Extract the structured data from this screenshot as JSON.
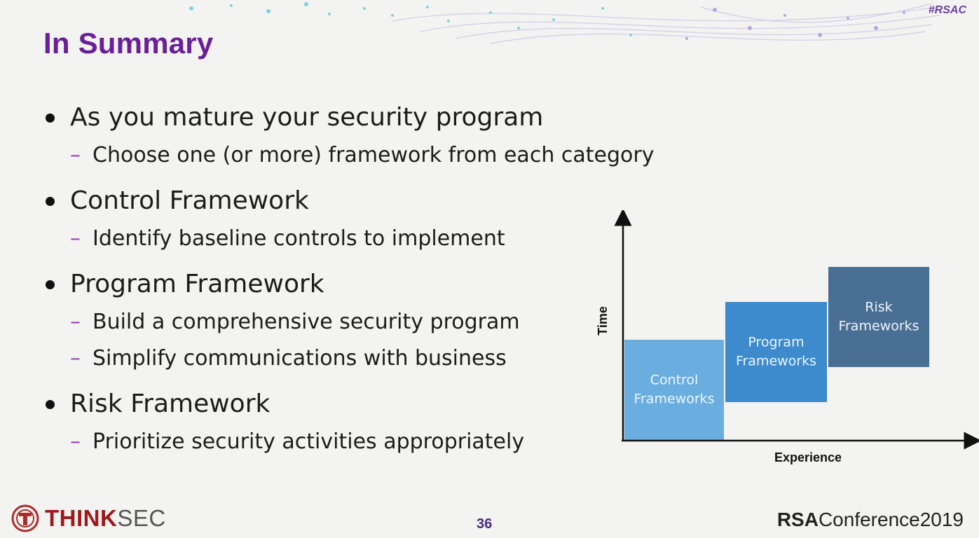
{
  "hashtag": "#RSAC",
  "title": "In Summary",
  "bullets": [
    {
      "text": "As you mature your security program",
      "subs": [
        "Choose one (or more) framework from each category"
      ]
    },
    {
      "text": "Control Framework",
      "subs": [
        "Identify baseline controls to implement"
      ]
    },
    {
      "text": "Program Framework",
      "subs": [
        "Build a comprehensive security program",
        "Simplify communications with business"
      ]
    },
    {
      "text": "Risk Framework",
      "subs": [
        "Prioritize security activities appropriately"
      ]
    }
  ],
  "chart_data": {
    "type": "bar",
    "xlabel": "Experience",
    "ylabel": "Time",
    "categories": [
      "Control Frameworks",
      "Program Frameworks",
      "Risk Frameworks"
    ],
    "colors": [
      "#6aaee0",
      "#3d8bcd",
      "#4a6f94"
    ]
  },
  "footer": {
    "logo_think": "THINK",
    "logo_sec": "SEC",
    "page_number": "36",
    "rsa_bold": "RSA",
    "rsa_rest": "Conference2019"
  }
}
